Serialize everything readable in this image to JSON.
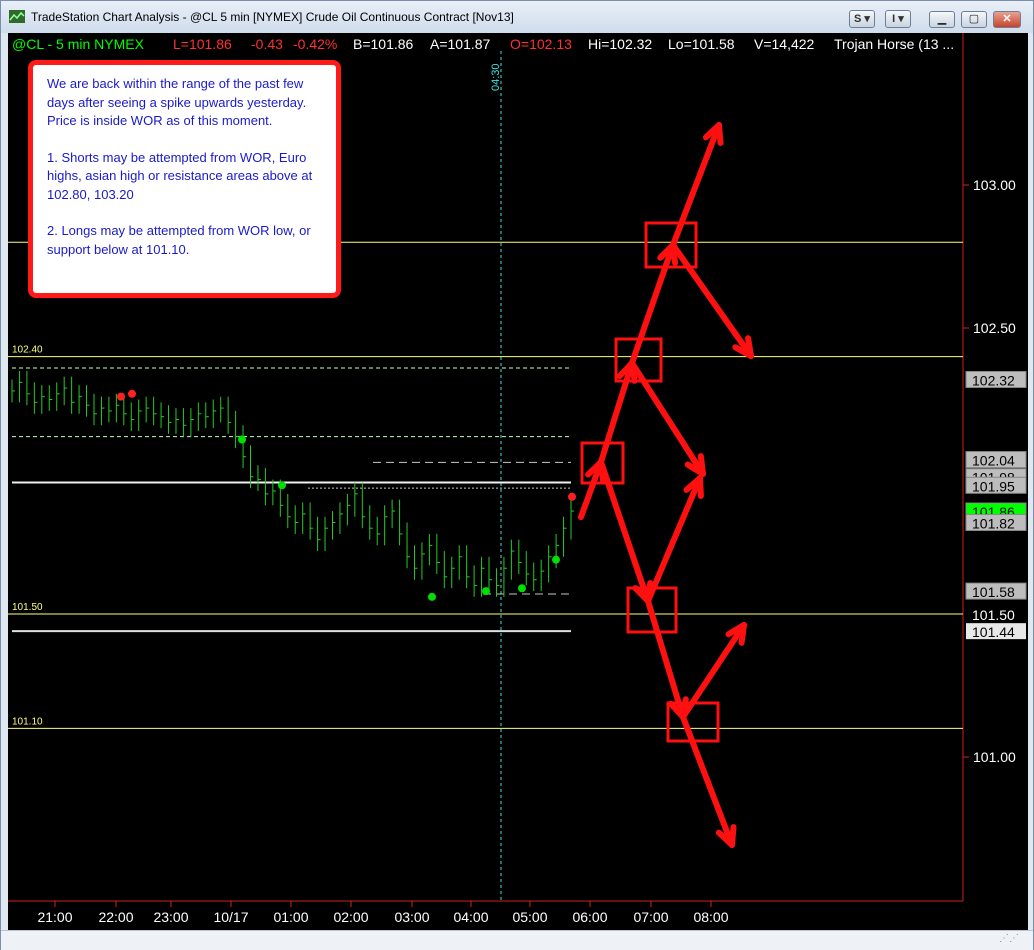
{
  "window": {
    "title": "TradeStation Chart Analysis - @CL 5 min [NYMEX] Crude Oil Continuous Contract [Nov13]",
    "toolbar_s": "S",
    "toolbar_i": "I"
  },
  "header": {
    "symbol": "@CL - 5 min  NYMEX",
    "last": "L=101.86",
    "change": "-0.43",
    "change_pct": "-0.42%",
    "bid": "B=101.86",
    "ask": "A=101.87",
    "open": "O=102.13",
    "high": "Hi=102.32",
    "low": "Lo=101.58",
    "volume": "V=14,422",
    "indicator": "Trojan Horse (13 ..."
  },
  "annotation": {
    "p1": "We are back within the range of the past few days after seeing a spike upwards yesterday. Price is inside WOR as of this moment.",
    "p2": "1. Shorts may be attempted from WOR, Euro highs, asian high or resistance areas above at 102.80, 103.20",
    "p3": "2. Longs may be attempted from WOR low, or support below at 101.10."
  },
  "vline_label": "04:30",
  "colors": {
    "background": "#000000",
    "bars": "#22cc22",
    "up_dot": "#00e000",
    "down_dot": "#ff2020",
    "level_line": "#ffff80",
    "white_line": "#ffffff",
    "arrow": "#ff1010",
    "last_price_box": "#00ff00"
  },
  "chart_data": {
    "type": "ohlc",
    "x_ticks": [
      "21:00",
      "22:00",
      "23:00",
      "10/17",
      "01:00",
      "02:00",
      "03:00",
      "04:00",
      "05:00",
      "06:00",
      "07:00",
      "08:00"
    ],
    "y_ticks": [
      "103.00",
      "102.50",
      "101.00"
    ],
    "ylim": [
      100.25,
      103.65
    ],
    "level_lines": [
      {
        "label": "102.40",
        "value": 102.4
      },
      {
        "label": "101.50",
        "value": 101.5
      },
      {
        "label": "101.10",
        "value": 101.1
      },
      {
        "label": "",
        "value": 102.8
      }
    ],
    "price_labels": [
      {
        "text": "102.32",
        "value": 102.32,
        "style": "gray"
      },
      {
        "text": "102.04",
        "value": 102.04,
        "style": "gray"
      },
      {
        "text": "101.98",
        "value": 101.98,
        "style": "gray"
      },
      {
        "text": "101.95",
        "value": 101.95,
        "style": "gray"
      },
      {
        "text": "101.86",
        "value": 101.86,
        "style": "last"
      },
      {
        "text": "101.82",
        "value": 101.82,
        "style": "gray"
      },
      {
        "text": "101.58",
        "value": 101.58,
        "style": "gray"
      },
      {
        "text": "101.50",
        "value": 101.5,
        "style": "white"
      },
      {
        "text": "101.44",
        "value": 101.44,
        "style": "white"
      }
    ],
    "price_series_close": [
      102.28,
      102.31,
      102.27,
      102.24,
      102.26,
      102.25,
      102.27,
      102.29,
      102.24,
      102.26,
      102.23,
      102.2,
      102.22,
      102.21,
      102.23,
      102.2,
      102.18,
      102.21,
      102.22,
      102.2,
      102.19,
      102.17,
      102.18,
      102.16,
      102.18,
      102.2,
      102.19,
      102.21,
      102.22,
      102.17,
      102.12,
      102.05,
      101.98,
      101.97,
      101.92,
      101.93,
      101.88,
      101.84,
      101.82,
      101.85,
      101.8,
      101.76,
      101.8,
      101.82,
      101.85,
      101.88,
      101.92,
      101.84,
      101.8,
      101.78,
      101.84,
      101.86,
      101.78,
      101.7,
      101.66,
      101.71,
      101.74,
      101.68,
      101.63,
      101.66,
      101.7,
      101.63,
      101.6,
      101.66,
      101.62,
      101.6,
      101.66,
      101.72,
      101.68,
      101.64,
      101.62,
      101.65,
      101.7,
      101.74,
      101.8,
      101.86
    ]
  }
}
